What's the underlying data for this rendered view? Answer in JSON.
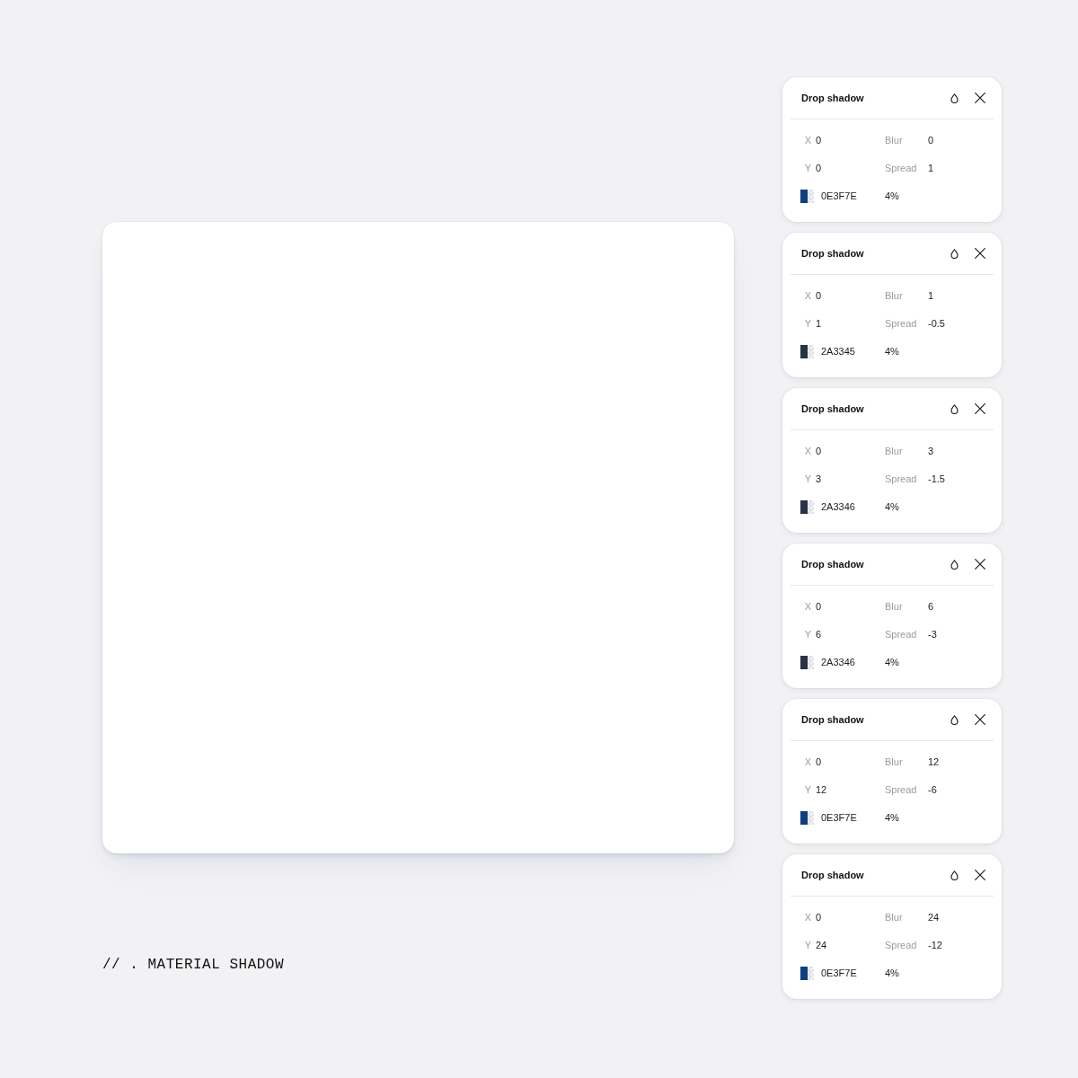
{
  "preview": {
    "caption": "// . MATERIAL SHADOW"
  },
  "shadows": [
    {
      "title": "Drop shadow",
      "fields": [
        {
          "label": "X",
          "value": "0"
        },
        {
          "label": "Blur",
          "value": "0"
        },
        {
          "label": "Y",
          "value": "0"
        },
        {
          "label": "Spread",
          "value": "1"
        }
      ],
      "fill": {
        "color": "#0e3f7e",
        "hex": "0E3F7E",
        "opacity": "4%"
      }
    },
    {
      "title": "Drop shadow",
      "fields": [
        {
          "label": "X",
          "value": "0"
        },
        {
          "label": "Blur",
          "value": "1"
        },
        {
          "label": "Y",
          "value": "1"
        },
        {
          "label": "Spread",
          "value": "-0.5"
        }
      ],
      "fill": {
        "color": "#2a3345",
        "hex": "2A3345",
        "opacity": "4%"
      }
    },
    {
      "title": "Drop shadow",
      "fields": [
        {
          "label": "X",
          "value": "0"
        },
        {
          "label": "Blur",
          "value": "3"
        },
        {
          "label": "Y",
          "value": "3"
        },
        {
          "label": "Spread",
          "value": "-1.5"
        }
      ],
      "fill": {
        "color": "#2a3346",
        "hex": "2A3346",
        "opacity": "4%"
      }
    },
    {
      "title": "Drop shadow",
      "fields": [
        {
          "label": "X",
          "value": "0"
        },
        {
          "label": "Blur",
          "value": "6"
        },
        {
          "label": "Y",
          "value": "6"
        },
        {
          "label": "Spread",
          "value": "-3"
        }
      ],
      "fill": {
        "color": "#2a3346",
        "hex": "2A3346",
        "opacity": "4%"
      }
    },
    {
      "title": "Drop shadow",
      "fields": [
        {
          "label": "X",
          "value": "0"
        },
        {
          "label": "Blur",
          "value": "12"
        },
        {
          "label": "Y",
          "value": "12"
        },
        {
          "label": "Spread",
          "value": "-6"
        }
      ],
      "fill": {
        "color": "#0e3f7e",
        "hex": "0E3F7E",
        "opacity": "4%"
      }
    },
    {
      "title": "Drop shadow",
      "fields": [
        {
          "label": "X",
          "value": "0"
        },
        {
          "label": "Blur",
          "value": "24"
        },
        {
          "label": "Y",
          "value": "24"
        },
        {
          "label": "Spread",
          "value": "-12"
        }
      ],
      "fill": {
        "color": "#0e3f7e",
        "hex": "0E3F7E",
        "opacity": "4%"
      }
    }
  ]
}
